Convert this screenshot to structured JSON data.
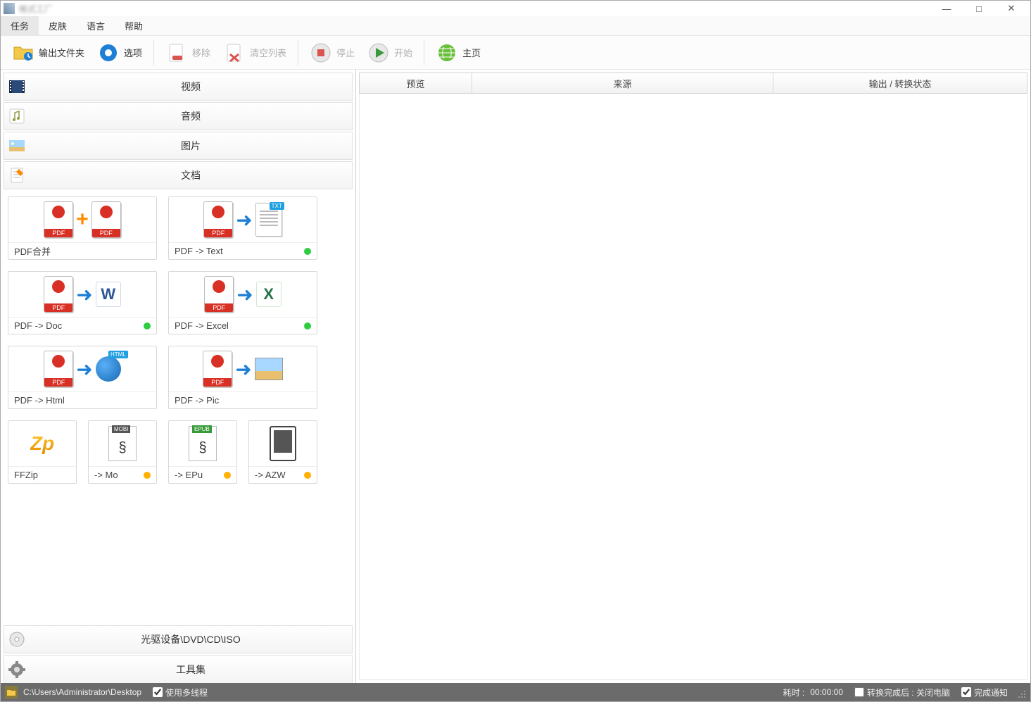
{
  "title": "格式工厂",
  "winbtns": {
    "min": "—",
    "max": "□",
    "close": "✕"
  },
  "menu": [
    "任务",
    "皮肤",
    "语言",
    "帮助"
  ],
  "toolbar": {
    "output": "输出文件夹",
    "options": "选项",
    "remove": "移除",
    "clear": "清空列表",
    "stop": "停止",
    "start": "开始",
    "home": "主页"
  },
  "categories": {
    "video": "视频",
    "audio": "音频",
    "image": "图片",
    "document": "文档"
  },
  "tiles": {
    "pdfmerge": "PDF合并",
    "pdftext": "PDF -> Text",
    "pdfdoc": "PDF -> Doc",
    "pdfexcel": "PDF -> Excel",
    "pdfhtml": "PDF -> Html",
    "pdfpic": "PDF -> Pic",
    "ffzip": "FFZip",
    "mobi": "-> Mo",
    "epub": "-> EPu",
    "azw": "-> AZW"
  },
  "tags": {
    "txt": "TXT",
    "html": "HTML",
    "mobi": "MOBI",
    "epub": "EPUB"
  },
  "botcats": {
    "optical": "光驱设备\\DVD\\CD\\ISO",
    "toolset": "工具集"
  },
  "columns": {
    "preview": "预览",
    "source": "来源",
    "status": "输出 / 转换状态"
  },
  "statusbar": {
    "path": "C:\\Users\\Administrator\\Desktop",
    "multithread": "使用多线程",
    "elapsed_label": "耗时 :",
    "elapsed_time": "00:00:00",
    "aftercomplete": "转换完成后 : 关闭电脑",
    "notify": "完成通知"
  }
}
